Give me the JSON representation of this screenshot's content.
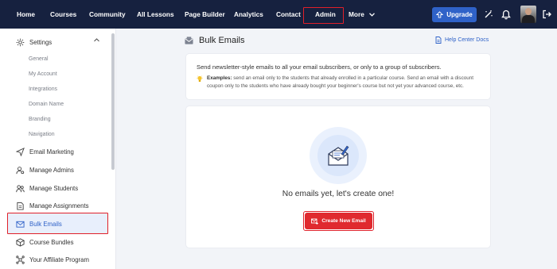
{
  "nav": {
    "items": [
      "Home",
      "Courses",
      "Community",
      "All Lessons",
      "Page Builder",
      "Analytics",
      "Contact",
      "Admin",
      "More"
    ],
    "upgrade_label": "Upgrade"
  },
  "sidebar": {
    "settings_label": "Settings",
    "settings_sub": [
      "General",
      "My Account",
      "Integrations",
      "Domain Name",
      "Branding",
      "Navigation"
    ],
    "items": [
      "Email Marketing",
      "Manage Admins",
      "Manage Students",
      "Manage Assignments",
      "Bulk Emails",
      "Course Bundles",
      "Your Affiliate Program"
    ]
  },
  "main": {
    "title": "Bulk Emails",
    "help_link": "Help Center Docs",
    "intro": "Send newsletter-style emails to all your email subscribers, or only to a group of subscribers.",
    "example_label": "Examples:",
    "example_line1": "send an email only to the students that already enrolled in a particular course. Send an email with a discount",
    "example_line2": "coupon only to the students who have already bought your beginner's course but not yet your advanced course, etc.",
    "empty_message": "No emails yet, let's create one!",
    "create_button": "Create New Email"
  },
  "colors": {
    "nav_bg": "#16213f",
    "accent_blue": "#2f62c8",
    "create_red": "#e02a2f",
    "highlight_red": "#e0202a"
  },
  "icons": [
    "upgrade-arrow-icon",
    "magic-wand-icon",
    "bell-icon",
    "logout-icon",
    "gear-icon",
    "chevron-up-icon",
    "send-icon",
    "admin-gear-icon",
    "students-icon",
    "assignment-icon",
    "mail-icon",
    "bundle-icon",
    "affiliate-icon",
    "email-title-icon",
    "doc-icon",
    "lightbulb-icon",
    "envelope-pen-icon",
    "add-mail-icon"
  ]
}
